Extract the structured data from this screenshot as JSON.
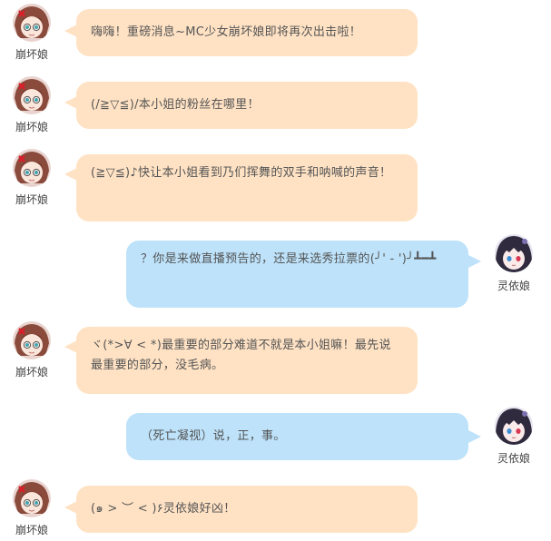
{
  "characters": {
    "honkai": {
      "name": "崩坏娘",
      "avatar_icon": "honkai-girl-avatar-icon",
      "bubble_color": "#ffe2c4"
    },
    "lingyi": {
      "name": "灵依娘",
      "avatar_icon": "lingyi-girl-avatar-icon",
      "bubble_color": "#bde2fa"
    }
  },
  "messages": [
    {
      "speaker": "崩坏娘",
      "side": "left",
      "text": "嗨嗨！重磅消息~MC少女崩坏娘即将再次出击啦！"
    },
    {
      "speaker": "崩坏娘",
      "side": "left",
      "text": "(/≧▽≦)/本小姐的粉丝在哪里！"
    },
    {
      "speaker": "崩坏娘",
      "side": "left",
      "text": "(≧▽≦)♪快让本小姐看到乃们挥舞的双手和呐喊的声音！"
    },
    {
      "speaker": "灵依娘",
      "side": "right",
      "text": "？你是来做直播预告的，还是来选秀拉票的(╯' - ')╯┻━┻"
    },
    {
      "speaker": "崩坏娘",
      "side": "left",
      "text": "ヾ(*>∀ < *)最重要的部分难道不就是本小姐嘛！最先说最重要的部分，没毛病。"
    },
    {
      "speaker": "灵依娘",
      "side": "right",
      "text": "（死亡凝视）说，正，事。"
    },
    {
      "speaker": "崩坏娘",
      "side": "left",
      "text": "(๑ > ︶ < )۶灵依娘好凶！"
    }
  ]
}
